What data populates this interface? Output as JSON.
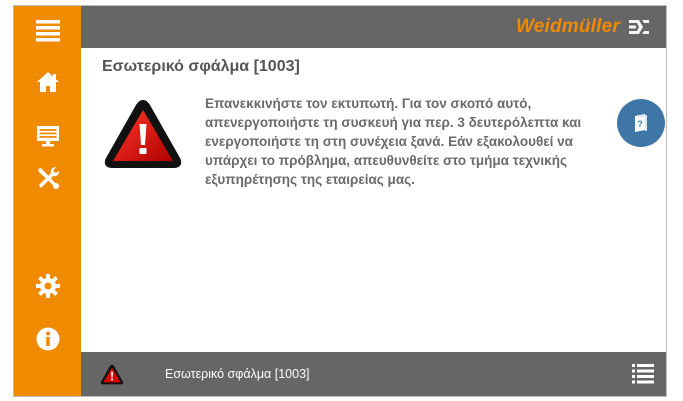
{
  "brand": {
    "name": "Weidmüller",
    "accent_color": "#f08a00"
  },
  "sidebar": {
    "items": [
      {
        "icon": "menu-icon"
      },
      {
        "icon": "home-icon"
      },
      {
        "icon": "monitor-icon"
      },
      {
        "icon": "tools-icon"
      },
      {
        "icon": "gear-icon"
      },
      {
        "icon": "info-icon"
      }
    ]
  },
  "error": {
    "title": "Εσωτερικό σφάλμα [1003]",
    "message": "Επανεκκινήστε τον εκτυπωτή. Για τον σκοπό αυτό, απενεργοποιήστε τη συσκευή για περ. 3 δευτερόλεπτα και ενεργοποιήστε τη στη συνέχεια ξανά. Εάν εξακολουθεί να υπάρχει το πρόβλημα, απευθυνθείτε στο τμήμα τεχνικής εξυπηρέτησης της εταιρείας μας.",
    "icon": "warning-icon",
    "help_icon": "help-book-icon"
  },
  "status_bar": {
    "text": "Εσωτερικό σφάλμα [1003]",
    "icon": "warning-icon",
    "list_icon": "message-list-icon"
  }
}
